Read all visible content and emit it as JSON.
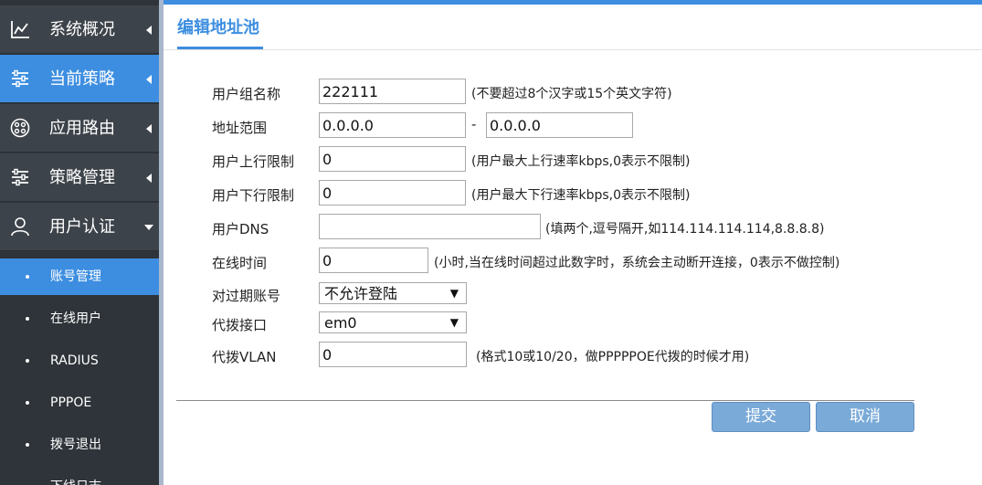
{
  "sidebar": {
    "menus": [
      {
        "label": "系统概况",
        "icon": "chart-line-icon"
      },
      {
        "label": "当前策略",
        "icon": "sliders-icon"
      },
      {
        "label": "应用路由",
        "icon": "network-circle-icon"
      },
      {
        "label": "策略管理",
        "icon": "sliders-icon"
      },
      {
        "label": "用户认证",
        "icon": "user-icon"
      }
    ],
    "sub_items": [
      {
        "label": "账号管理"
      },
      {
        "label": "在线用户"
      },
      {
        "label": "RADIUS"
      },
      {
        "label": "PPPOE"
      },
      {
        "label": "拨号退出"
      },
      {
        "label": "下线日志"
      }
    ]
  },
  "page": {
    "title": "编辑地址池"
  },
  "form": {
    "group_name": {
      "label": "用户组名称",
      "value": "222111",
      "hint": "(不要超过8个汉字或15个英文字符)"
    },
    "address_range": {
      "label": "地址范围",
      "start": "0.0.0.0",
      "separator": "-",
      "end": "0.0.0.0"
    },
    "upload_limit": {
      "label": "用户上行限制",
      "value": "0",
      "hint": "(用户最大上行速率kbps,0表示不限制)"
    },
    "download_limit": {
      "label": "用户下行限制",
      "value": "0",
      "hint": "(用户最大下行速率kbps,0表示不限制)"
    },
    "dns": {
      "label": "用户DNS",
      "value": "",
      "hint": "(填两个,逗号隔开,如114.114.114.114,8.8.8.8)"
    },
    "online_time": {
      "label": "在线时间",
      "value": "0",
      "hint": "(小时,当在线时间超过此数字时，系统会主动断开连接，0表示不做控制)"
    },
    "expired_account": {
      "label": "对过期账号",
      "selected": "不允许登陆"
    },
    "dial_interface": {
      "label": "代拨接口",
      "selected": "em0"
    },
    "dial_vlan": {
      "label": "代拨VLAN",
      "value": "0",
      "hint": "(格式10或10/20，做PPPPPOE代拨的时候才用)"
    }
  },
  "buttons": {
    "submit": "提交",
    "cancel": "取消"
  },
  "colors": {
    "accent": "#3d8ee0",
    "sidebar_bg": "#2f343a",
    "menu_bg": "#3d434a",
    "button": "#7aaad8"
  }
}
